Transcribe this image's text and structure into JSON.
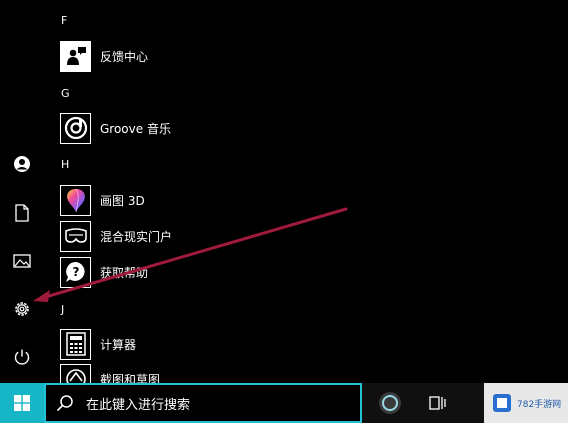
{
  "start_menu": {
    "groups": [
      {
        "letter": "F",
        "items": [
          {
            "label": "反馈中心",
            "icon": "feedback-hub-icon"
          }
        ]
      },
      {
        "letter": "G",
        "items": [
          {
            "label": "Groove 音乐",
            "icon": "groove-music-icon"
          }
        ]
      },
      {
        "letter": "H",
        "items": [
          {
            "label": "画图 3D",
            "icon": "paint-3d-icon"
          },
          {
            "label": "混合现实门户",
            "icon": "mixed-reality-icon"
          },
          {
            "label": "获取帮助",
            "icon": "get-help-icon"
          }
        ]
      },
      {
        "letter": "J",
        "items": [
          {
            "label": "计算器",
            "icon": "calculator-icon"
          },
          {
            "label": "截图和草图",
            "icon": "snip-sketch-icon"
          }
        ]
      }
    ],
    "rail": [
      "user-icon",
      "documents-icon",
      "pictures-icon",
      "settings-icon",
      "power-icon"
    ]
  },
  "taskbar": {
    "search_placeholder": "在此键入进行搜索",
    "watermark_text": "782手游网"
  },
  "colors": {
    "start_button": "#16b6c6",
    "search_border": "#23c2d2",
    "annotation_arrow": "#a01a3c"
  }
}
